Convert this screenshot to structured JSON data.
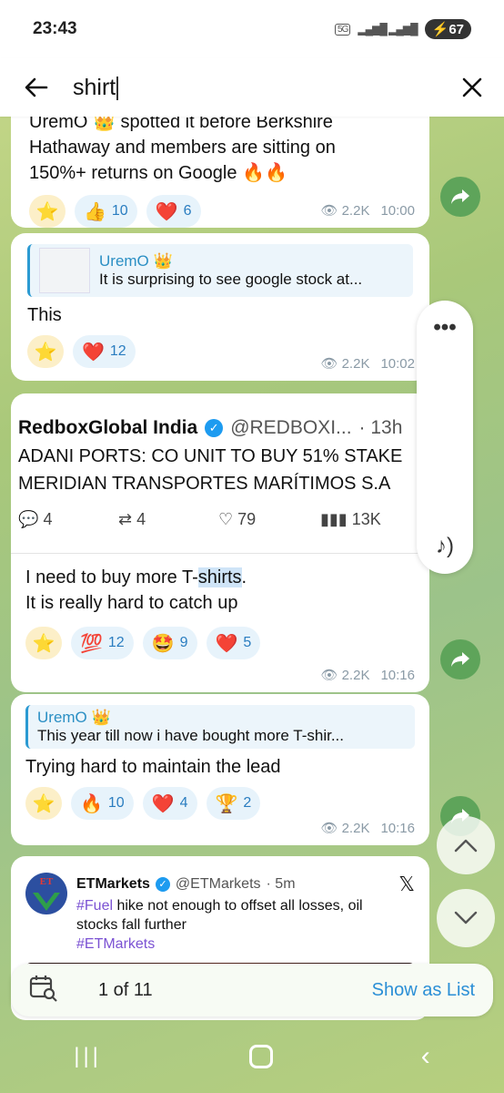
{
  "status": {
    "time": "23:43",
    "network": "5G",
    "battery": "67"
  },
  "search": {
    "query": "shirt"
  },
  "msg1": {
    "text_line1": "UremO 👑 spotted it before Berkshire",
    "text_line2": "Hathaway and members are sitting on",
    "text_line3": "150%+ returns on Google 🔥🔥",
    "reactions": [
      {
        "emoji": "👍",
        "count": "10"
      },
      {
        "emoji": "❤️",
        "count": "6"
      }
    ],
    "views": "2.2K",
    "time": "10:00"
  },
  "msg2": {
    "reply_author": "UremO 👑",
    "reply_text": "It is surprising to see google stock at...",
    "text": "This",
    "reactions": [
      {
        "emoji": "❤️",
        "count": "12"
      }
    ],
    "views": "2.2K",
    "time": "10:02"
  },
  "msg3": {
    "tweet_author": "RedboxGlobal India",
    "tweet_handle": "@REDBOXI...",
    "tweet_time": "· 13h",
    "tweet_line1": "ADANI PORTS: CO UNIT TO BUY 51% STAKE",
    "tweet_line2": "MERIDIAN TRANSPORTES MARÍTIMOS S.A",
    "tweet_replies": "4",
    "tweet_retweets": "4",
    "tweet_likes": "79",
    "tweet_views": "13K",
    "text_line1_pre": "I need to buy more T-",
    "text_line1_hl": "shirts",
    "text_line1_post": ".",
    "text_line2": "It is really hard to catch up",
    "reactions": [
      {
        "emoji": "💯",
        "count": "12"
      },
      {
        "emoji": "🤩",
        "count": "9"
      },
      {
        "emoji": "❤️",
        "count": "5"
      }
    ],
    "views": "2.2K",
    "time": "10:16"
  },
  "msg4": {
    "reply_author": "UremO 👑",
    "reply_text": "This year till now i have bought more T-shir...",
    "text": "Trying hard to maintain the lead",
    "reactions": [
      {
        "emoji": "🔥",
        "count": "10"
      },
      {
        "emoji": "❤️",
        "count": "4"
      },
      {
        "emoji": "🏆",
        "count": "2"
      }
    ],
    "views": "2.2K",
    "time": "10:16"
  },
  "msg5": {
    "tweet_author": "ETMarkets",
    "tweet_handle": "@ETMarkets",
    "tweet_time": "· 5m",
    "tweet_hashtag": "#Fuel",
    "tweet_line1": " hike not enough to offset all losses, oil",
    "tweet_line2": "stocks fall further",
    "tweet_tag2": "#ETMarkets"
  },
  "footer": {
    "counter": "1 of 11",
    "show_list": "Show as List"
  }
}
